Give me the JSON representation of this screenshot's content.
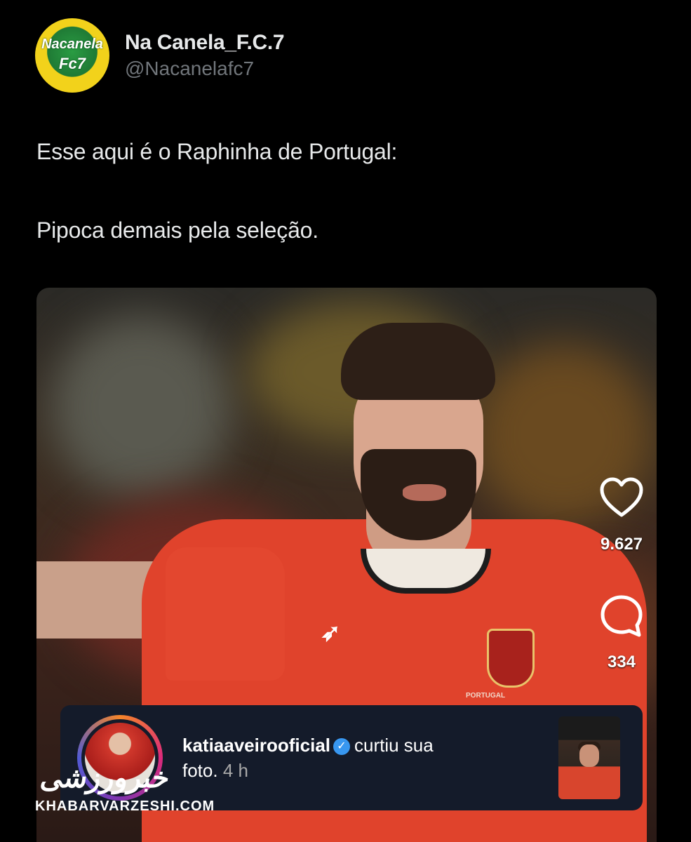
{
  "tweet": {
    "display_name": "Na Canela_F.C.7",
    "handle": "@Nacanelafc7",
    "avatar_text_top": "Nacanela",
    "avatar_text_bottom": "Fc7",
    "line1": "Esse aqui é o Raphinha de Portugal:",
    "line2": "Pipoca demais pela seleção."
  },
  "media": {
    "like_icon": "heart-icon",
    "like_count": "9.627",
    "comment_icon": "comment-icon",
    "comment_count": "334",
    "jersey_text": "PORTUGAL"
  },
  "notification": {
    "username": "katiaaveirooficial",
    "verified_icon": "verified-icon",
    "action": "curtiu sua",
    "action_end": "foto.",
    "time": "4 h"
  },
  "watermark": {
    "site": "KHABARVARZESHI.COM",
    "glyphs": "خبرورزشی"
  },
  "colors": {
    "background": "#000000",
    "text": "#e7e9ea",
    "muted": "#71767b",
    "jersey": "#e0432c",
    "notification_bg": "#141b2a",
    "verified": "#3897f0"
  }
}
